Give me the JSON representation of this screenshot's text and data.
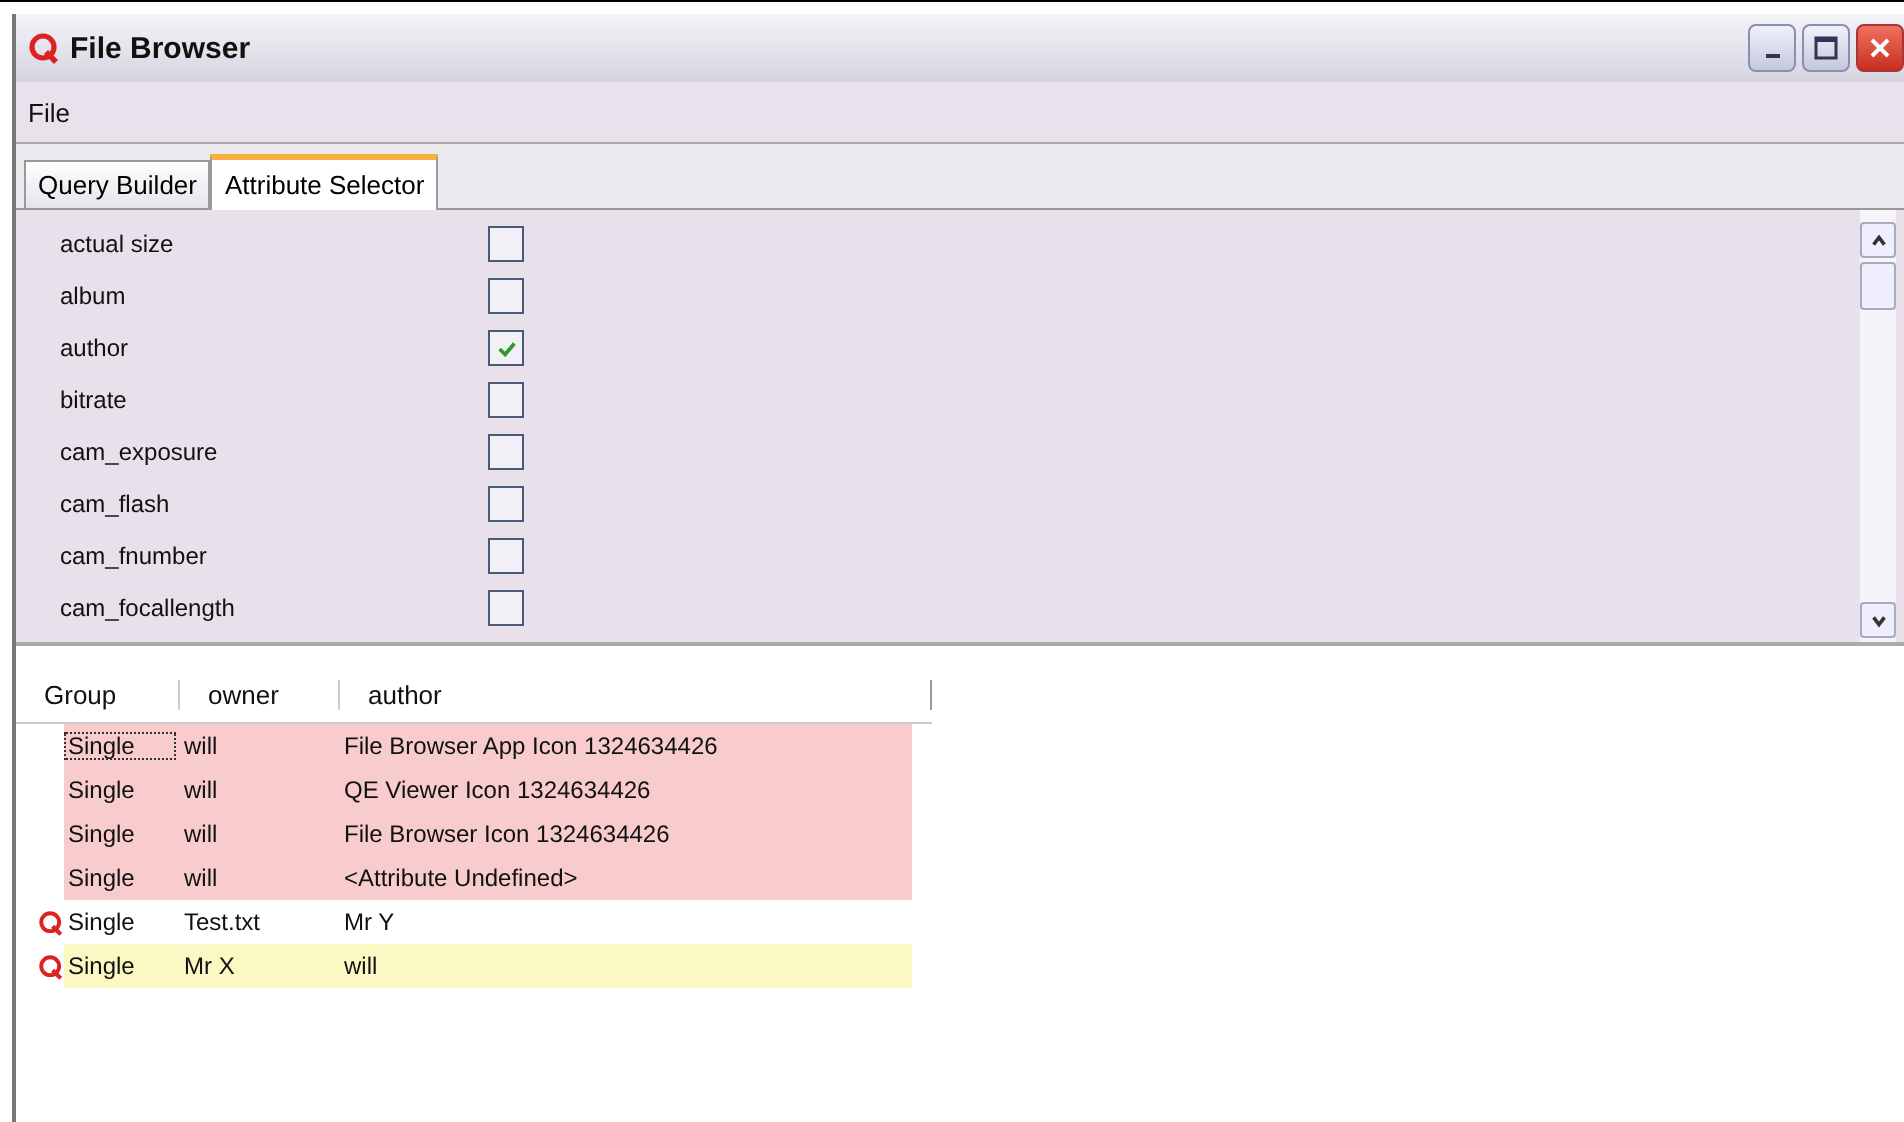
{
  "window": {
    "title": "File Browser"
  },
  "menu": [
    "File"
  ],
  "tabs": [
    {
      "label": "Query Builder",
      "selected": false
    },
    {
      "label": "Attribute Selector",
      "selected": true
    }
  ],
  "attributes": [
    {
      "name": "actual size",
      "checked": false
    },
    {
      "name": "album",
      "checked": false
    },
    {
      "name": "author",
      "checked": true
    },
    {
      "name": "bitrate",
      "checked": false
    },
    {
      "name": "cam_exposure",
      "checked": false
    },
    {
      "name": "cam_flash",
      "checked": false
    },
    {
      "name": "cam_fnumber",
      "checked": false
    },
    {
      "name": "cam_focallength",
      "checked": false
    }
  ],
  "table": {
    "columns": [
      "Group",
      "owner",
      "author"
    ],
    "rows": [
      {
        "cells": [
          "Single",
          "will",
          "File Browser App Icon 1324634426"
        ],
        "color": "#f8cccc",
        "icon": false,
        "focused": true
      },
      {
        "cells": [
          "Single",
          "will",
          "QE Viewer Icon 1324634426"
        ],
        "color": "#f8cccc",
        "icon": false,
        "focused": false
      },
      {
        "cells": [
          "Single",
          "will",
          "File Browser Icon 1324634426"
        ],
        "color": "#f8cccc",
        "icon": false,
        "focused": false
      },
      {
        "cells": [
          "Single",
          "will",
          "<Attribute Undefined>"
        ],
        "color": "#f8cccc",
        "icon": false,
        "focused": false
      },
      {
        "cells": [
          "Single",
          "Test.txt",
          "Mr Y"
        ],
        "icon": true,
        "focused": false
      },
      {
        "cells": [
          "Single",
          "Mr X",
          "will"
        ],
        "color": "#fbf8c4",
        "icon": true,
        "focused": false
      }
    ]
  }
}
